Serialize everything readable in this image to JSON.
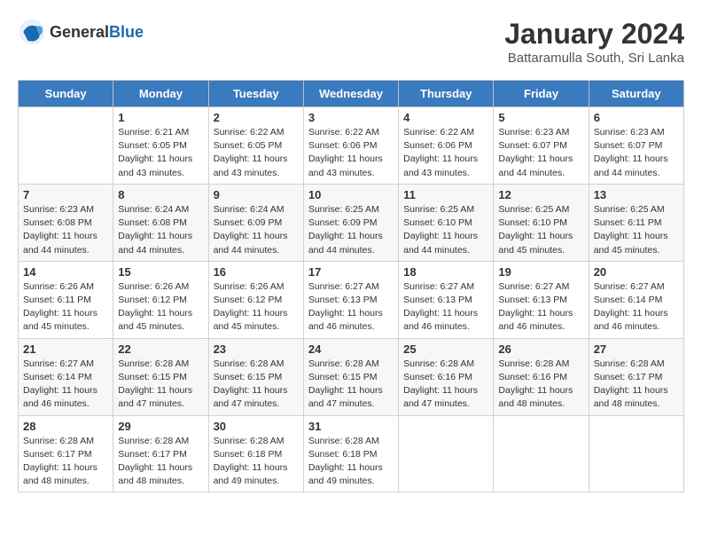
{
  "header": {
    "logo_general": "General",
    "logo_blue": "Blue",
    "month_year": "January 2024",
    "location": "Battaramulla South, Sri Lanka"
  },
  "weekdays": [
    "Sunday",
    "Monday",
    "Tuesday",
    "Wednesday",
    "Thursday",
    "Friday",
    "Saturday"
  ],
  "weeks": [
    [
      {
        "day": "",
        "info": ""
      },
      {
        "day": "1",
        "info": "Sunrise: 6:21 AM\nSunset: 6:05 PM\nDaylight: 11 hours\nand 43 minutes."
      },
      {
        "day": "2",
        "info": "Sunrise: 6:22 AM\nSunset: 6:05 PM\nDaylight: 11 hours\nand 43 minutes."
      },
      {
        "day": "3",
        "info": "Sunrise: 6:22 AM\nSunset: 6:06 PM\nDaylight: 11 hours\nand 43 minutes."
      },
      {
        "day": "4",
        "info": "Sunrise: 6:22 AM\nSunset: 6:06 PM\nDaylight: 11 hours\nand 43 minutes."
      },
      {
        "day": "5",
        "info": "Sunrise: 6:23 AM\nSunset: 6:07 PM\nDaylight: 11 hours\nand 44 minutes."
      },
      {
        "day": "6",
        "info": "Sunrise: 6:23 AM\nSunset: 6:07 PM\nDaylight: 11 hours\nand 44 minutes."
      }
    ],
    [
      {
        "day": "7",
        "info": "Sunrise: 6:23 AM\nSunset: 6:08 PM\nDaylight: 11 hours\nand 44 minutes."
      },
      {
        "day": "8",
        "info": "Sunrise: 6:24 AM\nSunset: 6:08 PM\nDaylight: 11 hours\nand 44 minutes."
      },
      {
        "day": "9",
        "info": "Sunrise: 6:24 AM\nSunset: 6:09 PM\nDaylight: 11 hours\nand 44 minutes."
      },
      {
        "day": "10",
        "info": "Sunrise: 6:25 AM\nSunset: 6:09 PM\nDaylight: 11 hours\nand 44 minutes."
      },
      {
        "day": "11",
        "info": "Sunrise: 6:25 AM\nSunset: 6:10 PM\nDaylight: 11 hours\nand 44 minutes."
      },
      {
        "day": "12",
        "info": "Sunrise: 6:25 AM\nSunset: 6:10 PM\nDaylight: 11 hours\nand 45 minutes."
      },
      {
        "day": "13",
        "info": "Sunrise: 6:25 AM\nSunset: 6:11 PM\nDaylight: 11 hours\nand 45 minutes."
      }
    ],
    [
      {
        "day": "14",
        "info": "Sunrise: 6:26 AM\nSunset: 6:11 PM\nDaylight: 11 hours\nand 45 minutes."
      },
      {
        "day": "15",
        "info": "Sunrise: 6:26 AM\nSunset: 6:12 PM\nDaylight: 11 hours\nand 45 minutes."
      },
      {
        "day": "16",
        "info": "Sunrise: 6:26 AM\nSunset: 6:12 PM\nDaylight: 11 hours\nand 45 minutes."
      },
      {
        "day": "17",
        "info": "Sunrise: 6:27 AM\nSunset: 6:13 PM\nDaylight: 11 hours\nand 46 minutes."
      },
      {
        "day": "18",
        "info": "Sunrise: 6:27 AM\nSunset: 6:13 PM\nDaylight: 11 hours\nand 46 minutes."
      },
      {
        "day": "19",
        "info": "Sunrise: 6:27 AM\nSunset: 6:13 PM\nDaylight: 11 hours\nand 46 minutes."
      },
      {
        "day": "20",
        "info": "Sunrise: 6:27 AM\nSunset: 6:14 PM\nDaylight: 11 hours\nand 46 minutes."
      }
    ],
    [
      {
        "day": "21",
        "info": "Sunrise: 6:27 AM\nSunset: 6:14 PM\nDaylight: 11 hours\nand 46 minutes."
      },
      {
        "day": "22",
        "info": "Sunrise: 6:28 AM\nSunset: 6:15 PM\nDaylight: 11 hours\nand 47 minutes."
      },
      {
        "day": "23",
        "info": "Sunrise: 6:28 AM\nSunset: 6:15 PM\nDaylight: 11 hours\nand 47 minutes."
      },
      {
        "day": "24",
        "info": "Sunrise: 6:28 AM\nSunset: 6:15 PM\nDaylight: 11 hours\nand 47 minutes."
      },
      {
        "day": "25",
        "info": "Sunrise: 6:28 AM\nSunset: 6:16 PM\nDaylight: 11 hours\nand 47 minutes."
      },
      {
        "day": "26",
        "info": "Sunrise: 6:28 AM\nSunset: 6:16 PM\nDaylight: 11 hours\nand 48 minutes."
      },
      {
        "day": "27",
        "info": "Sunrise: 6:28 AM\nSunset: 6:17 PM\nDaylight: 11 hours\nand 48 minutes."
      }
    ],
    [
      {
        "day": "28",
        "info": "Sunrise: 6:28 AM\nSunset: 6:17 PM\nDaylight: 11 hours\nand 48 minutes."
      },
      {
        "day": "29",
        "info": "Sunrise: 6:28 AM\nSunset: 6:17 PM\nDaylight: 11 hours\nand 48 minutes."
      },
      {
        "day": "30",
        "info": "Sunrise: 6:28 AM\nSunset: 6:18 PM\nDaylight: 11 hours\nand 49 minutes."
      },
      {
        "day": "31",
        "info": "Sunrise: 6:28 AM\nSunset: 6:18 PM\nDaylight: 11 hours\nand 49 minutes."
      },
      {
        "day": "",
        "info": ""
      },
      {
        "day": "",
        "info": ""
      },
      {
        "day": "",
        "info": ""
      }
    ]
  ]
}
